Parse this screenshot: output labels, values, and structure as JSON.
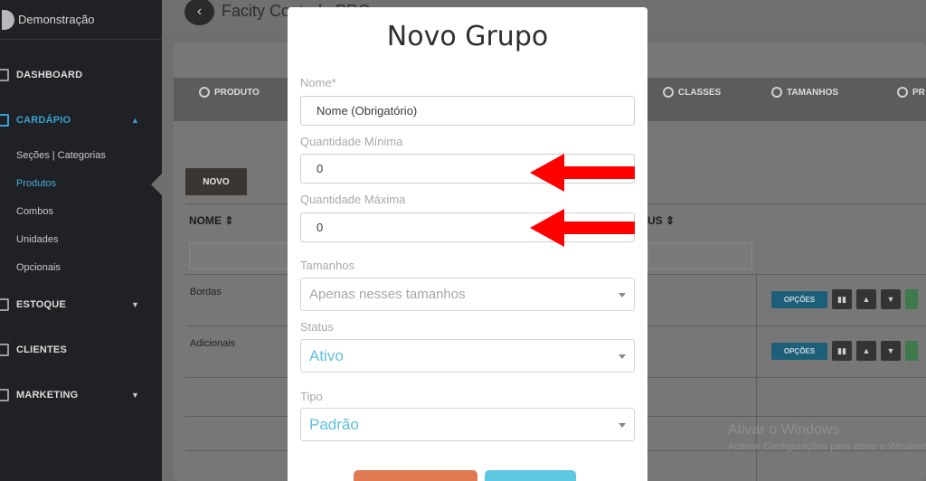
{
  "sidebar": {
    "user_name": "Demonstração",
    "items": [
      {
        "label": "DASHBOARD",
        "caret": ""
      },
      {
        "label": "CARDÁPIO",
        "caret": "▲"
      },
      {
        "label": "ESTOQUE",
        "caret": "▼"
      },
      {
        "label": "CLIENTES",
        "caret": ""
      },
      {
        "label": "MARKETING",
        "caret": "▼"
      }
    ],
    "sub_items": [
      "Seções | Categorias",
      "Produtos",
      "Combos",
      "Unidades",
      "Opcionais"
    ],
    "active_sub": "Produtos"
  },
  "header": {
    "back_icon": "‹",
    "title": "Facity Controle PRO"
  },
  "tabs": [
    {
      "label": "PRODUTO"
    },
    {
      "label": "CLASSES"
    },
    {
      "label": "TAMANHOS"
    },
    {
      "label": "PR"
    }
  ],
  "toolbar": {
    "novo_label": "NOVO"
  },
  "table": {
    "headers": [
      {
        "label": "NOME ⇕"
      },
      {
        "label": "US ⇕"
      }
    ],
    "rows": [
      {
        "name": "Bordas",
        "options_label": "OPÇÕES"
      },
      {
        "name": "Adicionais",
        "options_label": "OPÇÕES"
      }
    ],
    "pause_icon": "▮▮",
    "up_icon": "▲",
    "down_icon": "▼"
  },
  "watermark": {
    "title": "Ativar o Windows",
    "subtitle": "Acesse Configurações para ativar o Windows."
  },
  "modal": {
    "title": "Novo Grupo",
    "fields": {
      "nome": {
        "label": "Nome*",
        "value": "Nome (Obrigatório)"
      },
      "qtd_min": {
        "label": "Quantidade Mínima",
        "value": "0"
      },
      "qtd_max": {
        "label": "Quantidade Máxima",
        "value": "0"
      },
      "tamanhos": {
        "label": "Tamanhos",
        "placeholder": "Apenas nesses tamanhos"
      },
      "status": {
        "label": "Status",
        "value": "Ativo"
      },
      "tipo": {
        "label": "Tipo",
        "value": "Padrão"
      }
    }
  },
  "colors": {
    "accent": "#3aa3d4",
    "arrow": "#ff0000",
    "cancel_button": "#e07a52",
    "save_button": "#5ec8e3"
  }
}
